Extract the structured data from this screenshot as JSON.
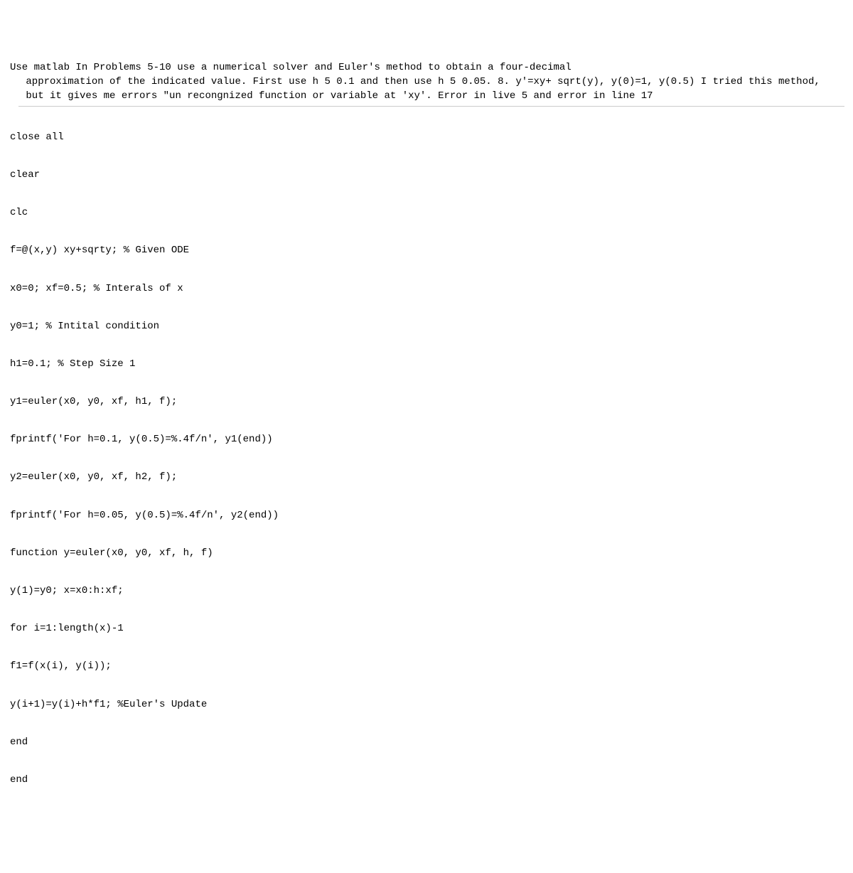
{
  "header": "Use matlab In Problems 5-10 use a numerical solver and Euler's method to obtain a four-decimal\n approximation of the indicated value. First use h 5 0.1 and then use h 5 0.05. 8. y'=xy+ sqrt(y), y(0)=1, y(0.5) I tried this method,\n but it gives me errors \"un recongnized function or variable at 'xy'. Error in live 5 and error in line 17",
  "lines": [
    "close all",
    "clear",
    "clc",
    "f=@(x,y) xy+sqrty; % Given ODE",
    "x0=0; xf=0.5; % Interals of x",
    "y0=1; % Intital condition",
    "h1=0.1; % Step Size 1",
    "y1=euler(x0, y0, xf, h1, f);",
    "fprintf('For h=0.1, y(0.5)=%.4f/n', y1(end))",
    "y2=euler(x0, y0, xf, h2, f);",
    "fprintf('For h=0.05, y(0.5)=%.4f/n', y2(end))",
    "function y=euler(x0, y0, xf, h, f)",
    "y(1)=y0; x=x0:h:xf;",
    "for i=1:length(x)-1",
    "f1=f(x(i), y(i));",
    "y(i+1)=y(i)+h*f1; %Euler's Update",
    "end",
    "end"
  ]
}
